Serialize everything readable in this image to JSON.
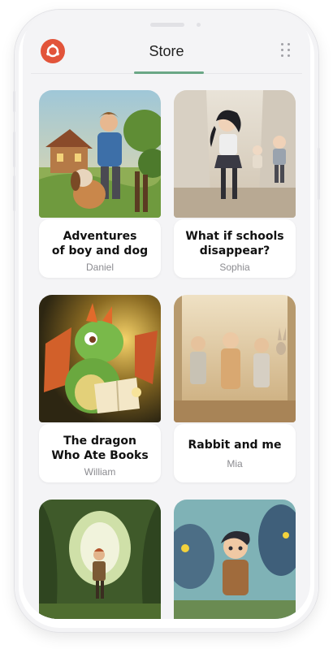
{
  "header": {
    "title": "Store"
  },
  "books": [
    {
      "title_line1": "Adventures",
      "title_line2": "of boy and dog",
      "author": "Daniel"
    },
    {
      "title_line1": "What if schools",
      "title_line2": "disappear?",
      "author": "Sophia"
    },
    {
      "title_line1": "The dragon",
      "title_line2": "Who Ate Books",
      "author": "William"
    },
    {
      "title_line1": "Rabbit and me",
      "title_line2": "",
      "author": "Mia"
    }
  ],
  "colors": {
    "accent": "#e2543a",
    "tab_indicator": "#6aa786",
    "background": "#f4f4f6"
  },
  "icons": {
    "logo": "ring-logo-icon",
    "menu": "grid-dots-icon"
  }
}
